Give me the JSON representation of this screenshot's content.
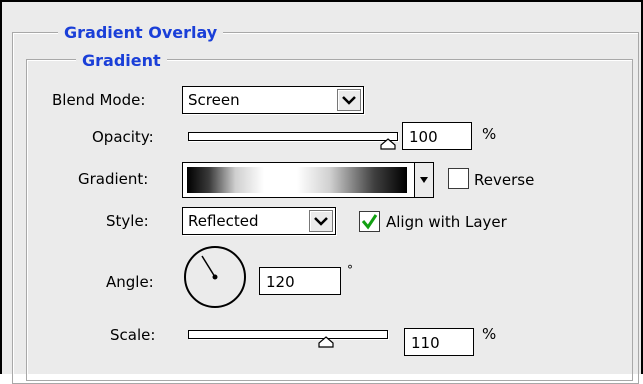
{
  "section_title": "Gradient Overlay",
  "group_title": "Gradient",
  "blend_mode": {
    "label": "Blend Mode:",
    "value": "Screen"
  },
  "opacity": {
    "label": "Opacity:",
    "value": "100",
    "unit": "%",
    "level": 1.0
  },
  "gradient": {
    "label": "Gradient:",
    "reverse_label": "Reverse",
    "reverse_checked": false
  },
  "style": {
    "label": "Style:",
    "value": "Reflected",
    "align_label": "Align with Layer",
    "align_checked": true
  },
  "angle": {
    "label": "Angle:",
    "value": "120",
    "unit": "°"
  },
  "scale": {
    "label": "Scale:",
    "value": "110",
    "unit": "%",
    "level": 0.55
  },
  "colors": {
    "legend": "#1a3fd8",
    "check": "#12a012",
    "panel": "#ebebeb"
  }
}
